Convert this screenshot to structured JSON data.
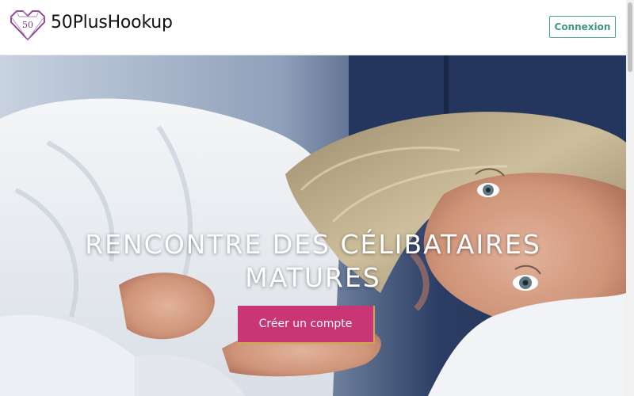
{
  "header": {
    "logo_icon": "heart-gem-icon",
    "logo_text": "50",
    "brand": "50PlusHookup",
    "login_label": "Connexion"
  },
  "hero": {
    "image": "woman-lying-in-bed-photo",
    "headline_line1": "RENCONTRE DES CÉLIBATAIRES",
    "headline_line2": "MATURES",
    "cta_label": "Créer un compte"
  },
  "colors": {
    "accent_green": "#4aa391",
    "cta_pink": "#c93575",
    "logo_purple": "#8a3d8f"
  }
}
